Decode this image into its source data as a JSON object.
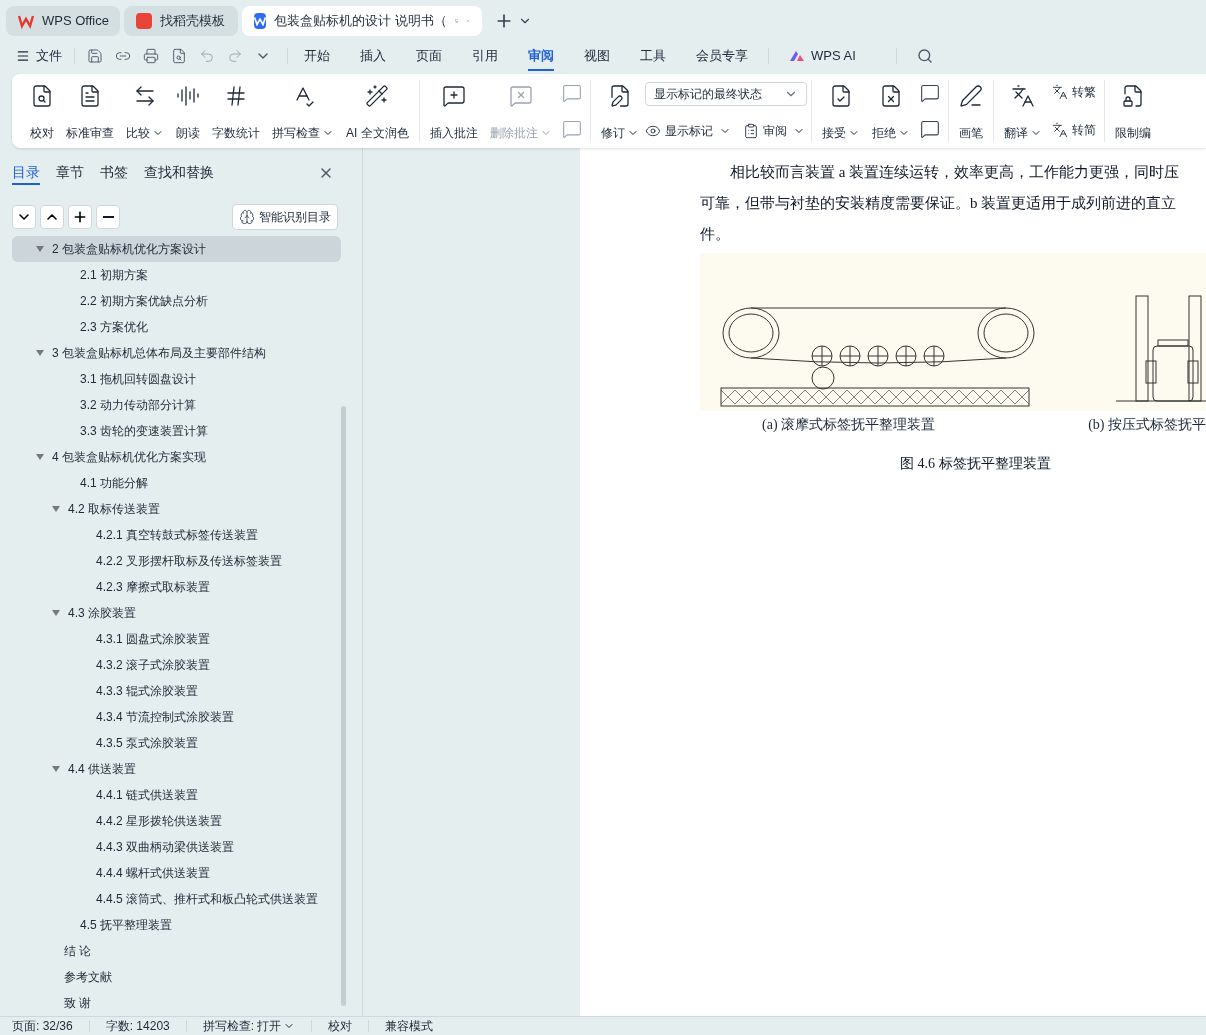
{
  "tabs": [
    {
      "label": "WPS Office",
      "kind": "wps",
      "selected": false
    },
    {
      "label": "找稻壳模板",
      "kind": "docer",
      "selected": false
    },
    {
      "label": "包装盒贴标机的设计 说明书（",
      "kind": "doc",
      "selected": true
    }
  ],
  "menu": {
    "file": "文件",
    "items": [
      {
        "label": "开始",
        "selected": false
      },
      {
        "label": "插入",
        "selected": false
      },
      {
        "label": "页面",
        "selected": false
      },
      {
        "label": "引用",
        "selected": false
      },
      {
        "label": "审阅",
        "selected": true
      },
      {
        "label": "视图",
        "selected": false
      },
      {
        "label": "工具",
        "selected": false
      },
      {
        "label": "会员专享",
        "selected": false
      }
    ],
    "ai": "WPS AI"
  },
  "ribbon": [
    [
      {
        "kind": "big",
        "label": "校对",
        "dropdown": false,
        "disabled": false
      },
      {
        "kind": "big",
        "label": "标准审查",
        "dropdown": false,
        "disabled": false
      },
      {
        "kind": "big",
        "label": "比较",
        "dropdown": true,
        "disabled": false
      },
      {
        "kind": "big",
        "label": "朗读",
        "dropdown": false,
        "disabled": false
      },
      {
        "kind": "big",
        "label": "字数统计",
        "dropdown": false,
        "disabled": false
      },
      {
        "kind": "big",
        "label": "拼写检查",
        "dropdown": true,
        "disabled": false
      },
      {
        "kind": "big",
        "label": "AI 全文润色",
        "dropdown": false,
        "disabled": false
      }
    ],
    [
      {
        "kind": "big",
        "label": "插入批注",
        "dropdown": false,
        "disabled": false
      },
      {
        "kind": "big",
        "label": "删除批注",
        "dropdown": true,
        "disabled": true
      },
      {
        "kind": "iconpair",
        "disabled": true
      }
    ],
    [
      {
        "kind": "big",
        "label": "修订",
        "dropdown": true,
        "disabled": false
      },
      {
        "kind": "select",
        "value": "显示标记的最终状态",
        "items": [
          {
            "label": "显示标记",
            "dropdown": true
          },
          {
            "label": "审阅",
            "dropdown": true
          }
        ]
      }
    ],
    [
      {
        "kind": "big",
        "label": "接受",
        "dropdown": true,
        "disabled": false
      },
      {
        "kind": "big",
        "label": "拒绝",
        "dropdown": true,
        "disabled": false
      },
      {
        "kind": "iconpair",
        "disabled": false
      }
    ],
    [
      {
        "kind": "big",
        "label": "画笔",
        "dropdown": false,
        "disabled": false
      }
    ],
    [
      {
        "kind": "big",
        "label": "翻译",
        "dropdown": true,
        "disabled": false
      },
      {
        "kind": "smallpair",
        "items": [
          {
            "label": "转繁"
          },
          {
            "label": "转简"
          }
        ]
      }
    ],
    [
      {
        "kind": "big",
        "label": "限制编",
        "dropdown": false,
        "disabled": false
      }
    ]
  ],
  "nav": {
    "tabs": [
      {
        "label": "目录",
        "selected": true
      },
      {
        "label": "章节",
        "selected": false
      },
      {
        "label": "书签",
        "selected": false
      },
      {
        "label": "查找和替换",
        "selected": false
      }
    ],
    "smart_button": "智能识别目录",
    "tree": [
      {
        "label": "2 包装盒贴标机优化方案设计",
        "expanded": true,
        "selected": true,
        "children": [
          {
            "label": "2.1  初期方案",
            "selected": false
          },
          {
            "label": "2.2  初期方案优缺点分析",
            "selected": false
          },
          {
            "label": "2.3  方案优化",
            "selected": false
          }
        ]
      },
      {
        "label": "3 包装盒贴标机总体布局及主要部件结构",
        "expanded": true,
        "selected": false,
        "children": [
          {
            "label": "3.1 拖机回转圆盘设计",
            "selected": false
          },
          {
            "label": "3.2 动力传动部分计算",
            "selected": false
          },
          {
            "label": "3.3 齿轮的变速装置计算",
            "selected": false
          }
        ]
      },
      {
        "label": "4 包装盒贴标机优化方案实现",
        "expanded": true,
        "selected": false,
        "children": [
          {
            "label": "4.1  功能分解",
            "selected": false
          },
          {
            "label": "4.2  取标传送装置",
            "expanded": true,
            "selected": false,
            "children": [
              {
                "label": "4.2.1  真空转鼓式标签传送装置",
                "selected": false
              },
              {
                "label": "4.2.2  叉形摆杆取标及传送标签装置",
                "selected": false
              },
              {
                "label": "4.2.3  摩擦式取标装置",
                "selected": false
              }
            ]
          },
          {
            "label": "4.3  涂胶装置",
            "expanded": true,
            "selected": false,
            "children": [
              {
                "label": "4.3.1  圆盘式涂胶装置",
                "selected": false
              },
              {
                "label": "4.3.2  滚子式涂胶装置",
                "selected": false
              },
              {
                "label": "4.3.3  辊式涂胶装置",
                "selected": false
              },
              {
                "label": "4.3.4 节流控制式涂胶装置",
                "selected": false
              },
              {
                "label": "4.3.5  泵式涂胶装置",
                "selected": false
              }
            ]
          },
          {
            "label": "4.4  供送装置",
            "expanded": true,
            "selected": false,
            "children": [
              {
                "label": "4.4.1  链式供送装置",
                "selected": false
              },
              {
                "label": "4.4.2  星形拨轮供送装置",
                "selected": false
              },
              {
                "label": "4.4.3  双曲柄动梁供送装置",
                "selected": false
              },
              {
                "label": "4.4.4  螺杆式供送装置",
                "selected": false
              },
              {
                "label": "4.4.5  滚筒式、推杆式和板凸轮式供送装置",
                "selected": false
              }
            ]
          },
          {
            "label": "4.5  抚平整理装置",
            "selected": false
          }
        ]
      },
      {
        "label": "结  论",
        "selected": false
      },
      {
        "label": "参考文献",
        "selected": false
      },
      {
        "label": "致  谢",
        "selected": false
      }
    ]
  },
  "document": {
    "paragraph_lines": [
      "相比较而言装置 a 装置连续运转，效率更高，工作能力更强，同时压",
      "可靠，但带与衬垫的安装精度需要保证。b 装置更适用于成列前进的直立",
      "件。"
    ],
    "subcaptions": [
      "(a) 滚摩式标签抚平整理装置",
      "(b) 按压式标签抚平"
    ],
    "caption": "图 4.6  标签抚平整理装置"
  },
  "status_bar": [
    {
      "label": "页面: 32/36",
      "dropdown": false
    },
    {
      "label": "字数: 14203",
      "dropdown": false
    },
    {
      "label": "拼写检查: 打开",
      "dropdown": true
    },
    {
      "label": "校对",
      "dropdown": false
    },
    {
      "label": "兼容模式",
      "dropdown": false
    }
  ]
}
